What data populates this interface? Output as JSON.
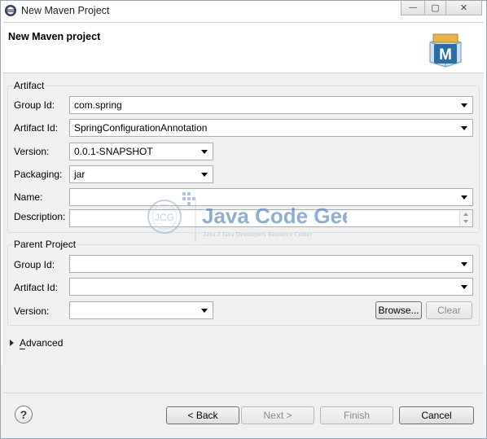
{
  "window": {
    "title": "New Maven Project",
    "minimize_glyph": "—",
    "restore_glyph": "▢",
    "close_glyph": "✕"
  },
  "header": {
    "title": "New Maven project",
    "logo_letter": "M"
  },
  "artifact": {
    "group_title": "Artifact",
    "group_id": {
      "label": "Group Id:",
      "value": "com.spring"
    },
    "artifact_id": {
      "label": "Artifact Id:",
      "value": "SpringConfigurationAnnotation"
    },
    "version": {
      "label": "Version:",
      "value": "0.0.1-SNAPSHOT"
    },
    "packaging": {
      "label": "Packaging:",
      "value": "jar"
    },
    "name": {
      "label": "Name:",
      "value": ""
    },
    "description": {
      "label": "Description:",
      "value": ""
    }
  },
  "parent": {
    "group_title": "Parent Project",
    "group_id": {
      "label": "Group Id:",
      "value": ""
    },
    "artifact_id": {
      "label": "Artifact Id:",
      "value": ""
    },
    "version": {
      "label": "Version:",
      "value": ""
    },
    "browse_label": "Browse...",
    "clear_label": "Clear"
  },
  "advanced": {
    "label": "Advanced"
  },
  "watermark": {
    "logo_text": "JCG",
    "title": "Java Code Geeks",
    "subtitle": "Java 2 Java Developers Resource Center"
  },
  "footer": {
    "help_glyph": "?",
    "back_label": "< Back",
    "next_label": "Next >",
    "finish_label": "Finish",
    "cancel_label": "Cancel"
  },
  "colors": {
    "accent": "#3c7fb1",
    "watermark": "#4a78b5",
    "disabled_text": "#8a8a8a"
  }
}
